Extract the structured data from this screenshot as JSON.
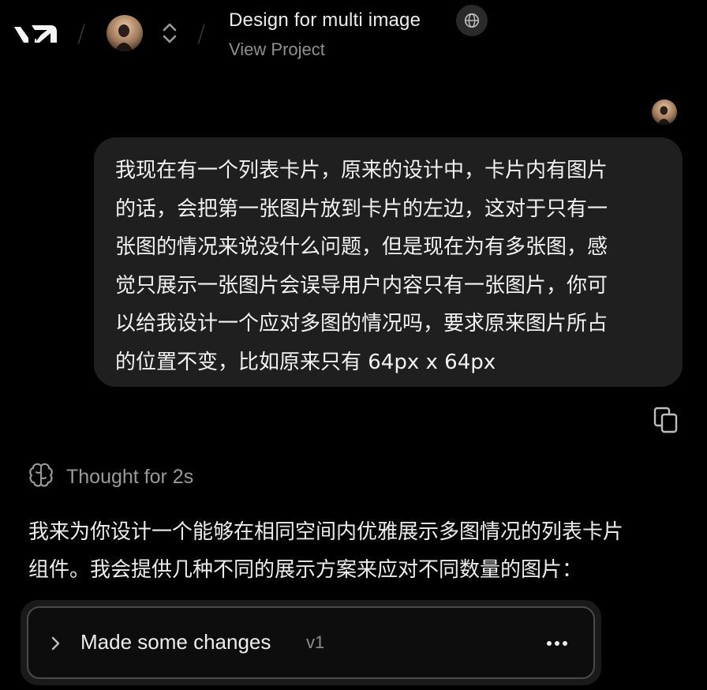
{
  "header": {
    "logo": "v0-logo",
    "separator": "/",
    "project_title": "Design for multi image",
    "subtitle": "View Project",
    "visibility_icon": "globe-icon",
    "switcher_icon": "chevron-up-down-icon"
  },
  "messages": {
    "user": {
      "text": "我现在有一个列表卡片，原来的设计中，卡片内有图片\n的话，会把第一张图片放到卡片的左边，这对于只有一\n张图的情况来说没什么问题，但是现在为有多张图，感\n觉只展示一张图片会误导用户内容只有一张图片，你可\n以给我设计一个应对多图的情况吗，要求原来图片所占\n的位置不变，比如原来只有 64px x 64px",
      "copy_icon": "copy-icon"
    },
    "assistant": {
      "thought_label": "Thought for 2s",
      "thought_icon": "brain-icon",
      "text": "我来为你设计一个能够在相同空间内优雅展示多图情况的列表卡片\n组件。我会提供几种不同的展示方案来应对不同数量的图片：",
      "changes": {
        "label": "Made some changes",
        "version": "v1",
        "expand_icon": "chevron-right-icon",
        "menu_icon": "more-horizontal-icon"
      }
    }
  },
  "colors": {
    "background": "#000000",
    "bubble": "#1f1f1f",
    "muted_text": "#8f8f8f"
  }
}
